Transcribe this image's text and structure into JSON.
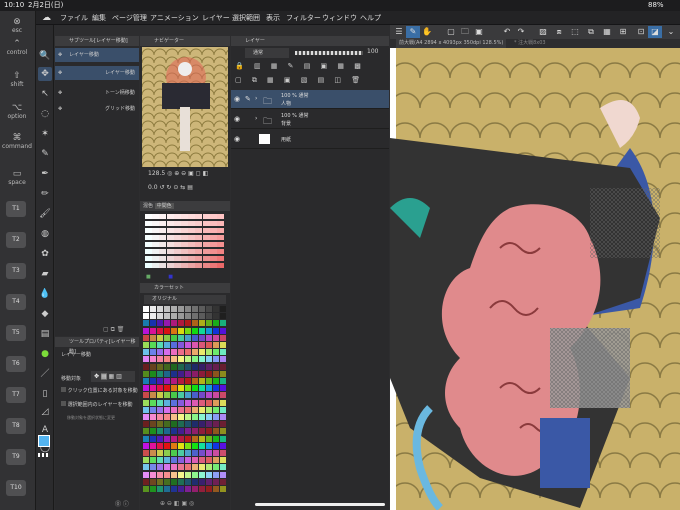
{
  "status": {
    "time": "10:10",
    "date": "2月2日(日)",
    "battery": "88%"
  },
  "menu": [
    "ファイル",
    "編集",
    "ページ管理",
    "アニメーション",
    "レイヤー",
    "選択範囲",
    "表示",
    "フィルター",
    "ウィンドウ",
    "ヘルプ"
  ],
  "commandbar": {
    "esc": "esc",
    "control": "control",
    "shift": "shift",
    "option": "option",
    "command": "command",
    "space": "space",
    "keys": [
      "T1",
      "T2",
      "T3",
      "T4",
      "T5",
      "T6",
      "T7",
      "T8",
      "T9",
      "T10"
    ]
  },
  "subtool": {
    "title": "サブツール[レイヤー移動]",
    "items": [
      "レイヤー移動",
      "レイヤー移動",
      "トーン柄移動",
      "グリッド移動"
    ]
  },
  "toolprop": {
    "title": "ツールプロパティ[レイヤー移動]",
    "subtitle": "レイヤー移動",
    "move_target": "移動対象",
    "opt1": "クリック位置にある対象を移動",
    "opt2": "選択範囲内のレイヤーを移動",
    "opt3": "移動対象を選択状態に変更"
  },
  "navigator": {
    "title": "ナビゲーター",
    "zoom": "128.5",
    "angle": "0.0"
  },
  "colormix": {
    "tab1": "混色",
    "tab2": "中間色"
  },
  "colorset": {
    "title": "カラーセット",
    "name": "オリジナル"
  },
  "layers": {
    "title": "レイヤー",
    "blend": "通常",
    "opacity": "100",
    "items": [
      {
        "pct": "100 % 通常",
        "name": "人物"
      },
      {
        "pct": "100 % 通常",
        "name": "背景"
      },
      {
        "pct": "",
        "name": "用紙"
      }
    ]
  },
  "canvas": {
    "tab1": "前大戦(A4 2894 x 4093px 350dpi 128.5%)",
    "tab2": "* 注大戦8x03"
  },
  "colors": {
    "accent": "#3a6ea5",
    "bg": "#2a2a2c"
  }
}
